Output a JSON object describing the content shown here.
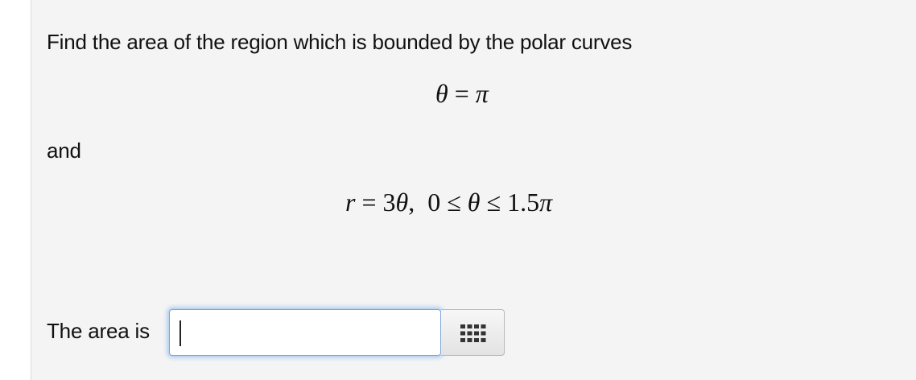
{
  "question": {
    "prompt": "Find the area of the region which is bounded by the polar curves",
    "conjunction": "and",
    "answer_label": "The area is"
  },
  "equations": {
    "curve1": {
      "lhs": "θ",
      "op": " = ",
      "rhs": "π"
    },
    "curve2": {
      "r": "r",
      "eq": " = ",
      "coef": "3",
      "theta": "θ",
      "sep": ",  ",
      "lo": "0",
      "le1": " ≤ ",
      "mid": "θ",
      "le2": " ≤ ",
      "hi": "1.5",
      "pi": "π"
    }
  },
  "answer": {
    "value": "",
    "placeholder": ""
  },
  "keypad": {
    "icon": "keypad-grid-icon"
  }
}
